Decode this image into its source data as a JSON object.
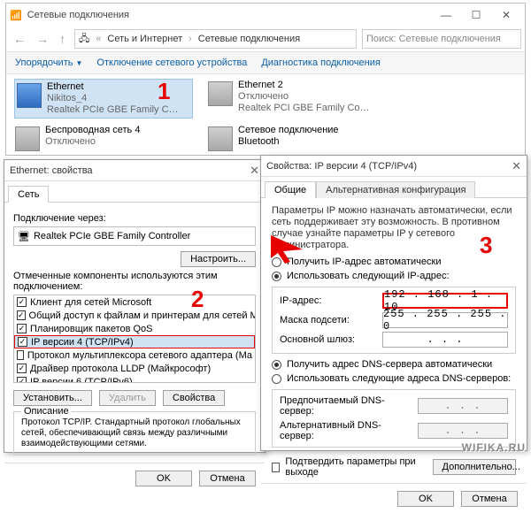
{
  "explorer": {
    "title": "Сетевые подключения",
    "breadcrumbs": [
      "Сеть и Интернет",
      "Сетевые подключения"
    ],
    "search_placeholder": "Поиск: Сетевые подключения",
    "toolbar": {
      "organize": "Упорядочить",
      "disable": "Отключение сетевого устройства",
      "diagnose": "Диагностика подключения"
    },
    "connections": [
      {
        "name": "Ethernet",
        "status": "Nikitos_4",
        "adapter": "Realtek PCIe GBE Family C…",
        "selected": true,
        "enabled": true
      },
      {
        "name": "Ethernet 2",
        "status": "Отключено",
        "adapter": "Realtek PCI GBE Family Co…",
        "selected": false,
        "enabled": false
      },
      {
        "name": "Беспроводная сеть 4",
        "status": "Отключено",
        "adapter": "",
        "selected": false,
        "enabled": false
      },
      {
        "name": "Сетевое подключение Bluetooth",
        "status": "",
        "adapter": "",
        "selected": false,
        "enabled": false
      }
    ]
  },
  "dlg_left": {
    "title": "Ethernet: свойства",
    "tab": "Сеть",
    "connect_via_label": "Подключение через:",
    "adapter": "Realtek PCIe GBE Family Controller",
    "configure_btn": "Настроить...",
    "components_label": "Отмеченные компоненты используются этим подключением:",
    "components": [
      {
        "name": "Клиент для сетей Microsoft",
        "checked": true
      },
      {
        "name": "Общий доступ к файлам и принтерам для сетей Mi",
        "checked": true
      },
      {
        "name": "Планировщик пакетов QoS",
        "checked": true
      },
      {
        "name": "IP версии 4 (TCP/IPv4)",
        "checked": true,
        "selected": true
      },
      {
        "name": "Протокол мультиплексора сетевого адаптера (Ма",
        "checked": false
      },
      {
        "name": "Драйвер протокола LLDP (Майкрософт)",
        "checked": true
      },
      {
        "name": "IP версии 6 (TCP/IPv6)",
        "checked": true
      }
    ],
    "btn_install": "Установить...",
    "btn_remove": "Удалить",
    "btn_props": "Свойства",
    "desc_legend": "Описание",
    "desc_text": "Протокол TCP/IP. Стандартный протокол глобальных сетей, обеспечивающий связь между различными взаимодействующими сетями.",
    "btn_ok": "OK",
    "btn_cancel": "Отмена"
  },
  "dlg_right": {
    "title": "Свойства: IP версии 4 (TCP/IPv4)",
    "tab_general": "Общие",
    "tab_alt": "Альтернативная конфигурация",
    "intro": "Параметры IP можно назначать автоматически, если сеть поддерживает эту возможность. В противном случае узнайте параметры IP у сетевого администратора.",
    "radio_auto_ip": "Получить IP-адрес автоматически",
    "radio_manual_ip": "Использовать следующий IP-адрес:",
    "ip_label": "IP-адрес:",
    "mask_label": "Маска подсети:",
    "gateway_label": "Основной шлюз:",
    "ip_value": "192 . 168 .  1  .  10",
    "mask_value": "255 . 255 . 255 .  0",
    "gateway_value": ".     .     .",
    "radio_auto_dns": "Получить адрес DNS-сервера автоматически",
    "radio_manual_dns": "Использовать следующие адреса DNS-серверов:",
    "dns1_label": "Предпочитаемый DNS-сервер:",
    "dns2_label": "Альтернативный DNS-сервер:",
    "dns_empty": ".     .     .",
    "confirm_label": "Подтвердить параметры при выходе",
    "btn_advanced": "Дополнительно...",
    "btn_ok": "OK",
    "btn_cancel": "Отмена"
  },
  "annotations": {
    "num1": "1",
    "num2": "2",
    "num3": "3"
  },
  "watermark": "WIFIKA.RU"
}
